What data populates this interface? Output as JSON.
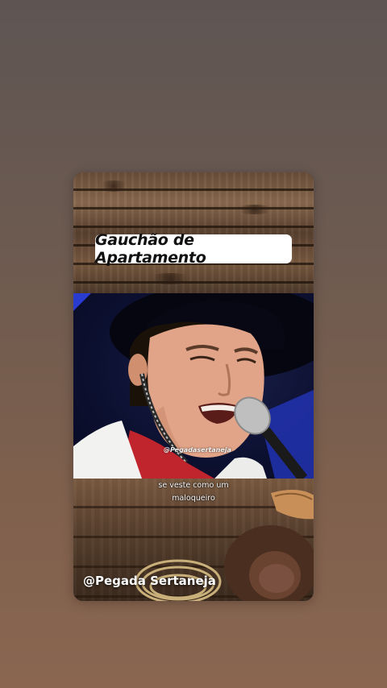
{
  "card": {
    "title": "Gauchão de Apartamento",
    "video_watermark": "@Pegadasertaneja",
    "subtitle_line1": "se veste como um",
    "subtitle_line2": "maloqueiro",
    "bottom_watermark": "@Pegada Sertaneja"
  },
  "colors": {
    "page_top": "#5e5553",
    "page_bottom": "#8a6650",
    "wood": "#6b4f3a",
    "stage_background": "#0c1030",
    "shirt_red": "#c0242c",
    "jacket_white": "#f2f2f0"
  },
  "icons": [
    "microphone-icon",
    "rope-lasso-icon",
    "cowboy-hat-icon"
  ]
}
